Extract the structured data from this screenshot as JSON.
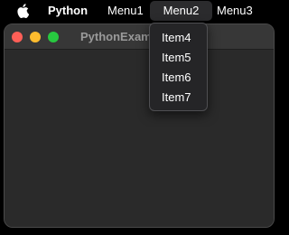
{
  "menubar": {
    "apple_icon": "apple-logo-icon",
    "app_name": "Python",
    "menus": [
      "Menu1",
      "Menu2",
      "Menu3"
    ],
    "open_menu": "Menu2"
  },
  "window": {
    "title": "PythonExam",
    "traffic_lights": {
      "close_color": "#ff5f57",
      "minimize_color": "#febc2e",
      "maximize_color": "#28c840"
    }
  },
  "dropdown": {
    "items": [
      "Item4",
      "Item5",
      "Item6",
      "Item7"
    ]
  }
}
